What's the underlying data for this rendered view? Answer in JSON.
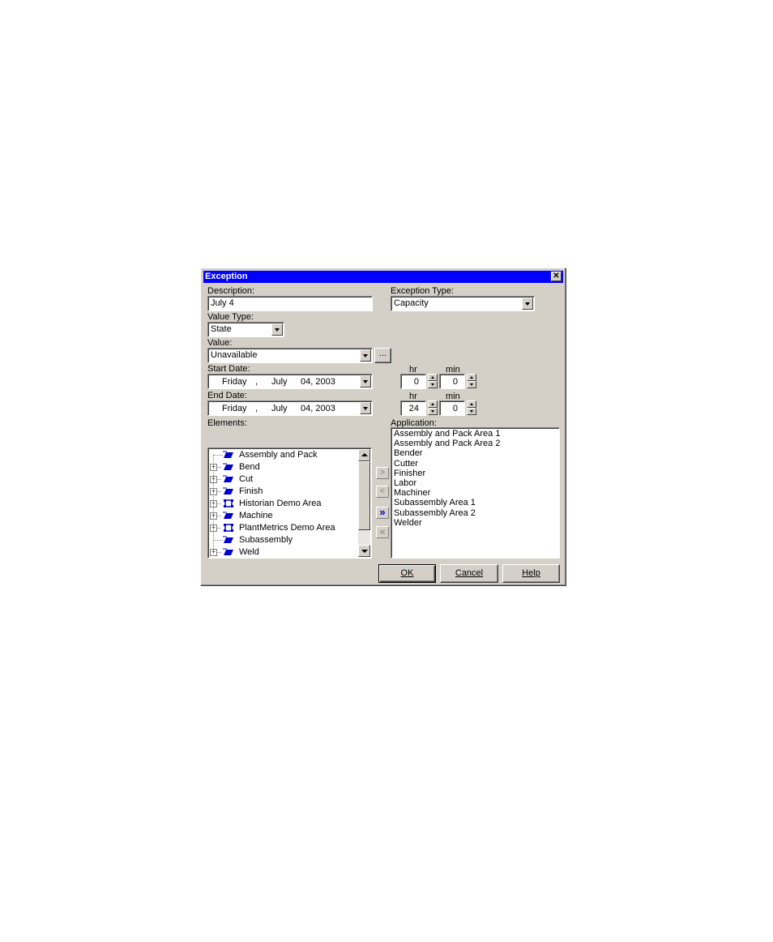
{
  "window": {
    "title": "Exception",
    "close_glyph": "✕"
  },
  "description": {
    "label": "Description:",
    "value": "July 4"
  },
  "exception_type": {
    "label": "Exception Type:",
    "value": "Capacity"
  },
  "value_type": {
    "label": "Value Type:",
    "value": "State"
  },
  "value": {
    "label": "Value:",
    "value": "Unavailable",
    "browse_label": "..."
  },
  "start_date": {
    "label": "Start Date:",
    "day": "Friday",
    "month": "July",
    "date": "04, 2003",
    "hr_label": "hr",
    "min_label": "min",
    "hr": "0",
    "min": "0"
  },
  "end_date": {
    "label": "End Date:",
    "day": "Friday",
    "month": "July",
    "date": "04, 2003",
    "hr_label": "hr",
    "min_label": "min",
    "hr": "24",
    "min": "0"
  },
  "elements": {
    "label": "Elements:",
    "items": [
      {
        "label": "Assembly and Pack",
        "expandable": false,
        "icon": "element-icon"
      },
      {
        "label": "Bend",
        "expandable": true,
        "icon": "element-icon"
      },
      {
        "label": "Cut",
        "expandable": true,
        "icon": "element-icon"
      },
      {
        "label": "Finish",
        "expandable": true,
        "icon": "element-icon"
      },
      {
        "label": "Historian Demo Area",
        "expandable": true,
        "icon": "area-icon"
      },
      {
        "label": "Machine",
        "expandable": true,
        "icon": "element-icon"
      },
      {
        "label": "PlantMetrics Demo Area",
        "expandable": true,
        "icon": "area-icon"
      },
      {
        "label": "Subassembly",
        "expandable": false,
        "icon": "element-icon"
      },
      {
        "label": "Weld",
        "expandable": true,
        "icon": "element-icon"
      }
    ]
  },
  "transfer": {
    "add": ">",
    "remove": "<",
    "add_all": "»",
    "remove_all": "«"
  },
  "application": {
    "label": "Application:",
    "items": [
      "Assembly and Pack Area 1",
      "Assembly and Pack Area 2",
      "Bender",
      "Cutter",
      "Finisher",
      "Labor",
      "Machiner",
      "Subassembly Area 1",
      "Subassembly Area 2",
      "Welder"
    ]
  },
  "buttons": {
    "ok": "OK",
    "cancel": "Cancel",
    "help": "Help"
  },
  "colors": {
    "title_bar": "#0000ff",
    "dialog_face": "#d4d0c8",
    "icon_blue": "#0000cc"
  }
}
